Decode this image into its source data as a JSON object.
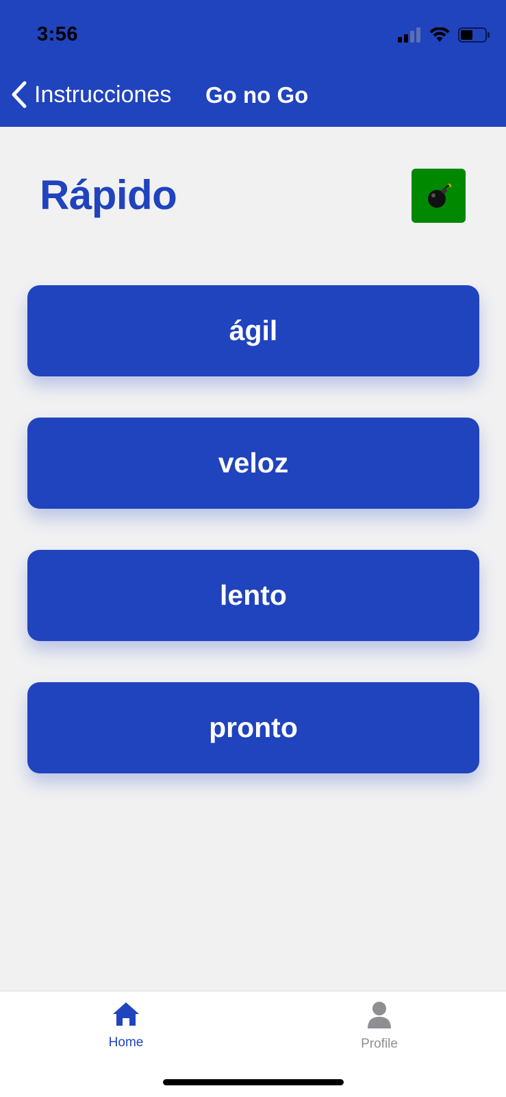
{
  "status_bar": {
    "time": "3:56"
  },
  "nav": {
    "back_label": "Instrucciones",
    "title": "Go no Go"
  },
  "prompt_word": "Rápido",
  "bomb_button": {
    "icon": "bomb-icon",
    "color": "#008800"
  },
  "options": [
    {
      "label": "ágil"
    },
    {
      "label": "veloz"
    },
    {
      "label": "lento"
    },
    {
      "label": "pronto"
    }
  ],
  "tabbar": {
    "tabs": [
      {
        "label": "Home",
        "icon": "home-icon",
        "active": true
      },
      {
        "label": "Profile",
        "icon": "person-icon",
        "active": false
      }
    ]
  },
  "colors": {
    "primary": "#2043be",
    "background": "#f1f1f2",
    "inactive": "#8e8e93"
  }
}
